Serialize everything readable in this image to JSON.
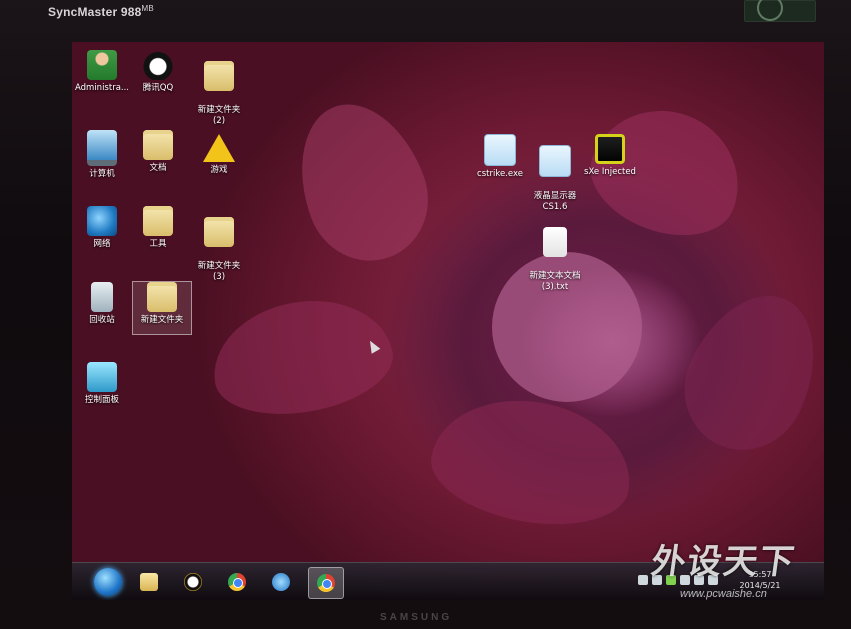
{
  "monitor": {
    "brand": "SyncMaster 988",
    "brand_suffix": "MB",
    "maker": "SAMSUNG"
  },
  "desktop": {
    "icons_col1": [
      {
        "label": "Administra...",
        "icon": "user-icon"
      },
      {
        "label": "计算机",
        "icon": "computer-icon"
      },
      {
        "label": "网络",
        "icon": "network-icon"
      },
      {
        "label": "回收站",
        "icon": "recycle-bin-icon"
      },
      {
        "label": "控制面板",
        "icon": "control-panel-icon"
      }
    ],
    "icons_col2": [
      {
        "label": "腾讯QQ",
        "icon": "qq-icon"
      },
      {
        "label": "文档",
        "icon": "folder-icon"
      },
      {
        "label": "工具",
        "icon": "folder-icon"
      },
      {
        "label": "新建文件夹",
        "icon": "folder-icon",
        "selected": true
      }
    ],
    "icons_col3": [
      {
        "label": "新建文件夹\n(2)",
        "icon": "folder-icon"
      },
      {
        "label": "游戏",
        "icon": "warning-icon"
      },
      {
        "label": "新建文件夹\n(3)",
        "icon": "folder-icon"
      }
    ],
    "icons_right": [
      {
        "label": "cstrike.exe",
        "icon": "counter-strike-icon"
      },
      {
        "label": "液晶显示器\nCS1.6",
        "icon": "counter-strike-icon"
      },
      {
        "label": "sXe Injected",
        "icon": "sxe-icon"
      },
      {
        "label": "新建文本文档\n(3).txt",
        "icon": "text-file-icon"
      }
    ]
  },
  "taskbar": {
    "items": [
      "windows-explorer-icon",
      "qq-icon",
      "chrome-icon",
      "internet-explorer-icon",
      "chrome-icon"
    ],
    "active_index": 4,
    "clock_time": "15:57",
    "clock_date": "2014/5/21"
  },
  "watermark": {
    "title": "外设天下",
    "url": "www.pcwaishe.cn"
  },
  "colors": {
    "wallpaper_red": "#b7252c",
    "flower_magenta": "#8e2d50",
    "taskbar_bg": "#1a1a22"
  }
}
